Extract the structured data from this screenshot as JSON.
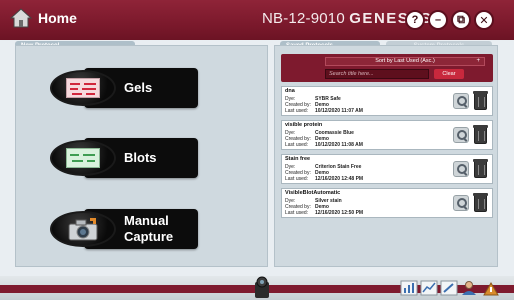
{
  "header": {
    "home_label": "Home",
    "device_prefix": "NB-12-9010",
    "device_brand": "GENESYS",
    "window_buttons": [
      {
        "icon": "help-icon",
        "glyph": "?"
      },
      {
        "icon": "minimize-icon",
        "glyph": "–"
      },
      {
        "icon": "restore-icon",
        "glyph": "⧉"
      },
      {
        "icon": "close-icon",
        "glyph": "✕"
      }
    ]
  },
  "left_panel": {
    "tab_label": "New Protocol",
    "buttons": [
      {
        "label": "Gels",
        "icon": "gel-icon"
      },
      {
        "label": "Blots",
        "icon": "blot-icon"
      },
      {
        "label": "Manual\nCapture",
        "icon": "camera-icon"
      }
    ]
  },
  "right_panel": {
    "tabs": [
      {
        "label": "Saved Protocols",
        "active": true
      },
      {
        "label": "System Protocols",
        "active": false
      }
    ],
    "sort_label": "Sort by Last Used (Asc.)",
    "sort_plus": "+",
    "search_placeholder": "Search title here...",
    "clear_label": "Clear",
    "row_keys": {
      "dye": "Dye:",
      "created": "Created by:",
      "last": "Last used:"
    },
    "protocols": [
      {
        "title": "dna",
        "dye": "SYBR Safe",
        "created_by": "Demo",
        "last_used": "10/12/2020 11:07 AM"
      },
      {
        "title": "visible protein",
        "dye": "Coomassie Blue",
        "created_by": "Demo",
        "last_used": "10/12/2020 11:08 AM"
      },
      {
        "title": "Stain free",
        "dye": "Criterion Stain Free",
        "created_by": "Demo",
        "last_used": "12/16/2020 12:48 PM"
      },
      {
        "title": "VisibleBlotAutomatic",
        "dye": "Silver stain",
        "created_by": "Demo",
        "last_used": "12/16/2020 12:50 PM"
      }
    ]
  },
  "colors": {
    "brand": "#7e1a2e",
    "panel": "#cfd9df",
    "button_face": "#0c0c0c"
  }
}
